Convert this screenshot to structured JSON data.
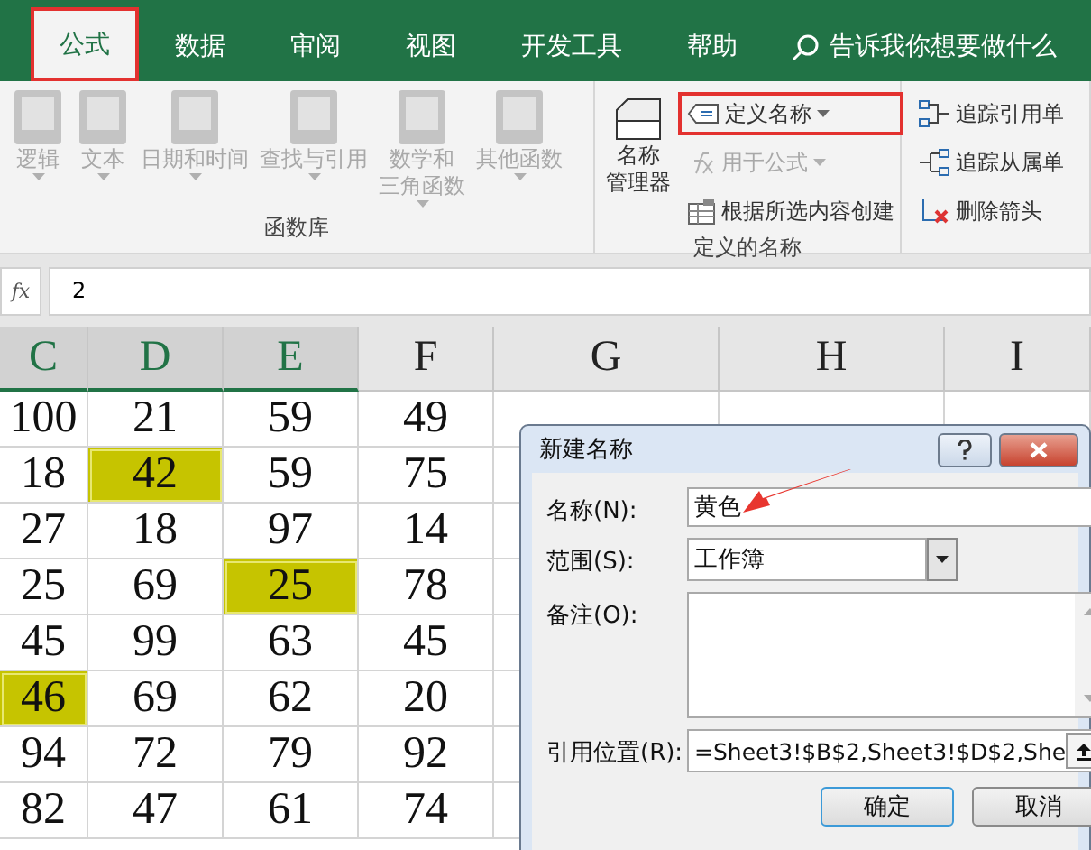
{
  "tabs": [
    {
      "label": "公式",
      "selected": true,
      "annotated": true
    },
    {
      "label": "数据",
      "selected": false,
      "annotated": false
    },
    {
      "label": "审阅",
      "selected": false,
      "annotated": false
    },
    {
      "label": "视图",
      "selected": false,
      "annotated": false
    },
    {
      "label": "开发工具",
      "selected": false,
      "annotated": false
    },
    {
      "label": "帮助",
      "selected": false,
      "annotated": false
    }
  ],
  "tell_me": "告诉我你想要做什么",
  "function_library": {
    "title": "函数库",
    "buttons": [
      {
        "lines": [
          "逻辑"
        ],
        "disabled": true
      },
      {
        "lines": [
          "文本"
        ],
        "disabled": true
      },
      {
        "lines": [
          "日期和时间"
        ],
        "disabled": true
      },
      {
        "lines": [
          "查找与引用"
        ],
        "disabled": true
      },
      {
        "lines": [
          "数学和",
          "三角函数"
        ],
        "disabled": true
      },
      {
        "lines": [
          "其他函数"
        ],
        "disabled": true
      }
    ]
  },
  "defined_names": {
    "title": "定义的名称",
    "manager": [
      "名称",
      "管理器"
    ],
    "items": [
      {
        "kind": "define",
        "label": "定义名称",
        "disabled": false,
        "annotated": true
      },
      {
        "kind": "use",
        "label": "用于公式",
        "disabled": true,
        "annotated": false
      },
      {
        "kind": "create",
        "label": "根据所选内容创建",
        "disabled": false,
        "annotated": false
      }
    ]
  },
  "auditing": {
    "items": [
      {
        "kind": "precedents",
        "label": "追踪引用单"
      },
      {
        "kind": "dependents",
        "label": "追踪从属单"
      },
      {
        "kind": "remove",
        "label": "删除箭头"
      }
    ]
  },
  "formula_bar": {
    "fx_label": "fx",
    "value": "2"
  },
  "sheet": {
    "columns": [
      {
        "label": "C",
        "selected": true
      },
      {
        "label": "D",
        "selected": true
      },
      {
        "label": "E",
        "selected": true
      },
      {
        "label": "F",
        "selected": false
      },
      {
        "label": "G",
        "selected": false
      },
      {
        "label": "H",
        "selected": false
      },
      {
        "label": "I",
        "selected": false
      }
    ],
    "rows": [
      [
        {
          "value": "100",
          "highlighted": false
        },
        {
          "value": "21",
          "highlighted": false
        },
        {
          "value": "59",
          "highlighted": false
        },
        {
          "value": "49",
          "highlighted": false
        }
      ],
      [
        {
          "value": "18",
          "highlighted": false
        },
        {
          "value": "42",
          "highlighted": true
        },
        {
          "value": "59",
          "highlighted": false
        },
        {
          "value": "75",
          "highlighted": false
        }
      ],
      [
        {
          "value": "27",
          "highlighted": false
        },
        {
          "value": "18",
          "highlighted": false
        },
        {
          "value": "97",
          "highlighted": false
        },
        {
          "value": "14",
          "highlighted": false
        }
      ],
      [
        {
          "value": "25",
          "highlighted": false
        },
        {
          "value": "69",
          "highlighted": false
        },
        {
          "value": "25",
          "highlighted": true
        },
        {
          "value": "78",
          "highlighted": false
        }
      ],
      [
        {
          "value": "45",
          "highlighted": false
        },
        {
          "value": "99",
          "highlighted": false
        },
        {
          "value": "63",
          "highlighted": false
        },
        {
          "value": "45",
          "highlighted": false
        }
      ],
      [
        {
          "value": "46",
          "highlighted": true
        },
        {
          "value": "69",
          "highlighted": false
        },
        {
          "value": "62",
          "highlighted": false
        },
        {
          "value": "20",
          "highlighted": false
        }
      ],
      [
        {
          "value": "94",
          "highlighted": false
        },
        {
          "value": "72",
          "highlighted": false
        },
        {
          "value": "79",
          "highlighted": false
        },
        {
          "value": "92",
          "highlighted": false
        }
      ],
      [
        {
          "value": "82",
          "highlighted": false
        },
        {
          "value": "47",
          "highlighted": false
        },
        {
          "value": "61",
          "highlighted": false
        },
        {
          "value": "74",
          "highlighted": false
        }
      ]
    ]
  },
  "dialog": {
    "title": "新建名称",
    "fields": [
      {
        "kind": "text",
        "label": "名称(N):",
        "value": "黄色"
      },
      {
        "kind": "select",
        "label": "范围(S):",
        "value": "工作簿"
      },
      {
        "kind": "textarea",
        "label": "备注(O):"
      },
      {
        "kind": "ref",
        "label": "引用位置(R):",
        "value": "=Sheet3!$B$2,Sheet3!$D$2,She"
      }
    ],
    "buttons": [
      {
        "label": "确定",
        "default": true
      },
      {
        "label": "取消",
        "default": false
      }
    ]
  }
}
